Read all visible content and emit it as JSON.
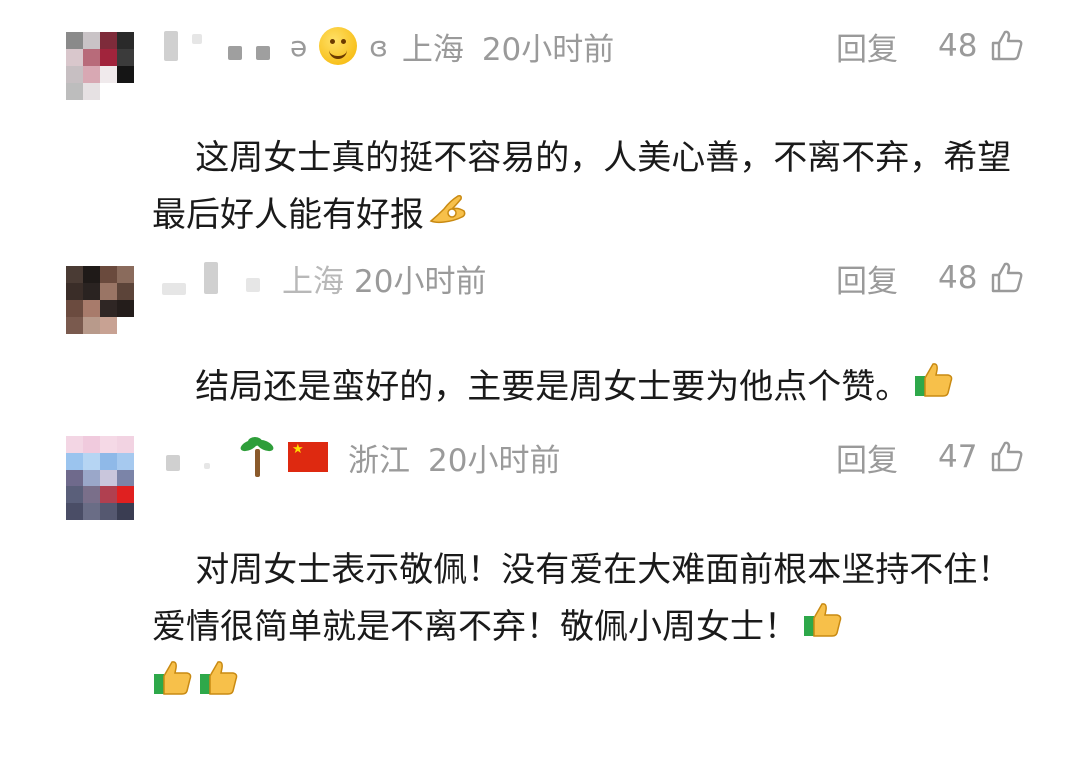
{
  "comments": [
    {
      "location": "上海",
      "time": "20小时前",
      "reply_label": "回复",
      "likes": "48",
      "content": "这周女士真的挺不容易的，人美心善，不离不弃，希望最后好人能有好报",
      "nick_chars": [
        "ə",
        "ɞ"
      ],
      "trailing_emojis": [
        "ok-hand-emoji"
      ]
    },
    {
      "location": "上海",
      "time": "20小时前",
      "reply_label": "回复",
      "likes": "48",
      "content": "结局还是蛮好的，主要是周女士要为他点个赞。",
      "trailing_emojis": [
        "thumbs-up-emoji"
      ]
    },
    {
      "location": "浙江",
      "time": "20小时前",
      "reply_label": "回复",
      "likes": "47",
      "content": "对周女士表示敬佩！没有爱在大难面前根本坚持不住！爱情很简单就是不离不弃！敬佩小周女士！",
      "trailing_emojis": [
        "thumbs-up-emoji",
        "thumbs-up-emoji",
        "thumbs-up-emoji"
      ]
    }
  ],
  "colors": {
    "meta_text": "#9a9a9a",
    "content_text": "#1a1a1a",
    "background": "#ffffff"
  }
}
